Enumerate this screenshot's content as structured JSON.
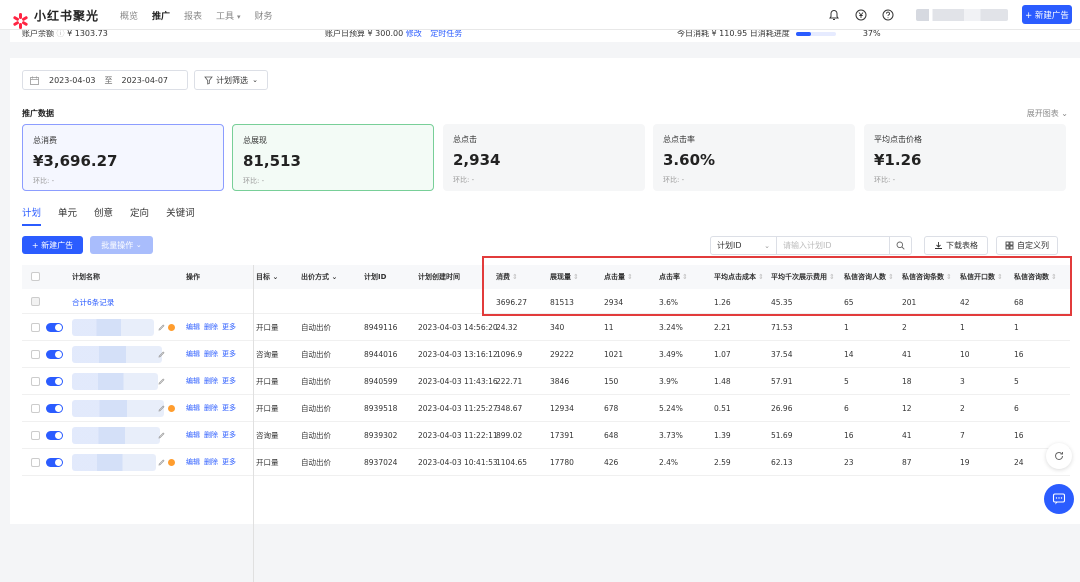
{
  "app": {
    "title": "小红书聚光",
    "nav": [
      "概览",
      "推广",
      "报表",
      "工具",
      "财务"
    ],
    "active_nav": "推广",
    "new_ad_button": "+ 新建广告"
  },
  "account": {
    "balance_label": "账户余额",
    "balance_value": "¥ 1303.73",
    "daily_budget_label": "账户日预算",
    "daily_budget_value": "¥ 300.00",
    "modify_link": "修改",
    "timed_task_link": "定时任务",
    "today_spend_label": "今日消耗",
    "today_spend_value": "¥ 110.95",
    "budget_progress_label": "日消耗进度",
    "budget_progress_percent": "37%",
    "budget_progress_fraction": 0.37
  },
  "filters": {
    "date_start": "2023-04-03",
    "date_sep": "至",
    "date_end": "2023-04-07",
    "plan_filter": "计划筛选"
  },
  "section": {
    "title": "推广数据",
    "expand_chart": "展开图表"
  },
  "stats": [
    {
      "label": "总消费",
      "value": "¥3,696.27",
      "sub": "环比: -"
    },
    {
      "label": "总展现",
      "value": "81,513",
      "sub": "环比: -"
    },
    {
      "label": "总点击",
      "value": "2,934",
      "sub": "环比: -"
    },
    {
      "label": "总点击率",
      "value": "3.60%",
      "sub": "环比: -"
    },
    {
      "label": "平均点击价格",
      "value": "¥1.26",
      "sub": "环比: -"
    }
  ],
  "tabs": [
    "计划",
    "单元",
    "创意",
    "定向",
    "关键词"
  ],
  "toolbar": {
    "new_ad": "+ 新建广告",
    "batch_ops": "批量操作",
    "search_select": "计划ID",
    "search_placeholder": "请输入计划ID",
    "download": "下载表格",
    "custom_columns": "自定义列"
  },
  "table": {
    "headers": {
      "name": "计划名称",
      "ops": "操作",
      "goal": "目标",
      "bid": "出价方式",
      "id": "计划ID",
      "created": "计划创建时间",
      "spend": "消费",
      "impressions": "展现量",
      "clicks": "点击量",
      "ctr": "点击率",
      "cpc": "平均点击成本",
      "cpm": "平均千次展示费用",
      "dm_people": "私信咨询人数",
      "dm_count": "私信咨询条数",
      "dm_open": "私信开口数",
      "dm_msgs": "私信咨询数"
    },
    "summary": {
      "label": "合计6条记录",
      "spend": "3696.27",
      "impressions": "81513",
      "clicks": "2934",
      "ctr": "3.6%",
      "cpc": "1.26",
      "cpm": "45.35",
      "dm_people": "65",
      "dm_count": "201",
      "dm_open": "42",
      "dm_msgs": "68"
    },
    "op_labels": {
      "edit": "编辑",
      "delete": "删除",
      "more": "更多"
    },
    "rows": [
      {
        "goal": "开口量",
        "bid": "自动出价",
        "id": "8949116",
        "created": "2023-04-03 14:56:20",
        "spend": "24.32",
        "impressions": "340",
        "clicks": "11",
        "ctr": "3.24%",
        "cpc": "2.21",
        "cpm": "71.53",
        "dm_people": "1",
        "dm_count": "2",
        "dm_open": "1",
        "dm_msgs": "1"
      },
      {
        "goal": "咨询量",
        "bid": "自动出价",
        "id": "8944016",
        "created": "2023-04-03 13:16:12",
        "spend": "1096.9",
        "impressions": "29222",
        "clicks": "1021",
        "ctr": "3.49%",
        "cpc": "1.07",
        "cpm": "37.54",
        "dm_people": "14",
        "dm_count": "41",
        "dm_open": "10",
        "dm_msgs": "16"
      },
      {
        "goal": "开口量",
        "bid": "自动出价",
        "id": "8940599",
        "created": "2023-04-03 11:43:16",
        "spend": "222.71",
        "impressions": "3846",
        "clicks": "150",
        "ctr": "3.9%",
        "cpc": "1.48",
        "cpm": "57.91",
        "dm_people": "5",
        "dm_count": "18",
        "dm_open": "3",
        "dm_msgs": "5"
      },
      {
        "goal": "开口量",
        "bid": "自动出价",
        "id": "8939518",
        "created": "2023-04-03 11:25:27",
        "spend": "348.67",
        "impressions": "12934",
        "clicks": "678",
        "ctr": "5.24%",
        "cpc": "0.51",
        "cpm": "26.96",
        "dm_people": "6",
        "dm_count": "12",
        "dm_open": "2",
        "dm_msgs": "6"
      },
      {
        "goal": "咨询量",
        "bid": "自动出价",
        "id": "8939302",
        "created": "2023-04-03 11:22:11",
        "spend": "899.02",
        "impressions": "17391",
        "clicks": "648",
        "ctr": "3.73%",
        "cpc": "1.39",
        "cpm": "51.69",
        "dm_people": "16",
        "dm_count": "41",
        "dm_open": "7",
        "dm_msgs": "16"
      },
      {
        "goal": "开口量",
        "bid": "自动出价",
        "id": "8937024",
        "created": "2023-04-03 10:41:53",
        "spend": "1104.65",
        "impressions": "17780",
        "clicks": "426",
        "ctr": "2.4%",
        "cpc": "2.59",
        "cpm": "62.13",
        "dm_people": "23",
        "dm_count": "87",
        "dm_open": "19",
        "dm_msgs": "24"
      }
    ]
  },
  "colors": {
    "accent": "#2b5cff",
    "highlight": "#e23b3b",
    "brand": "#ff2442"
  }
}
